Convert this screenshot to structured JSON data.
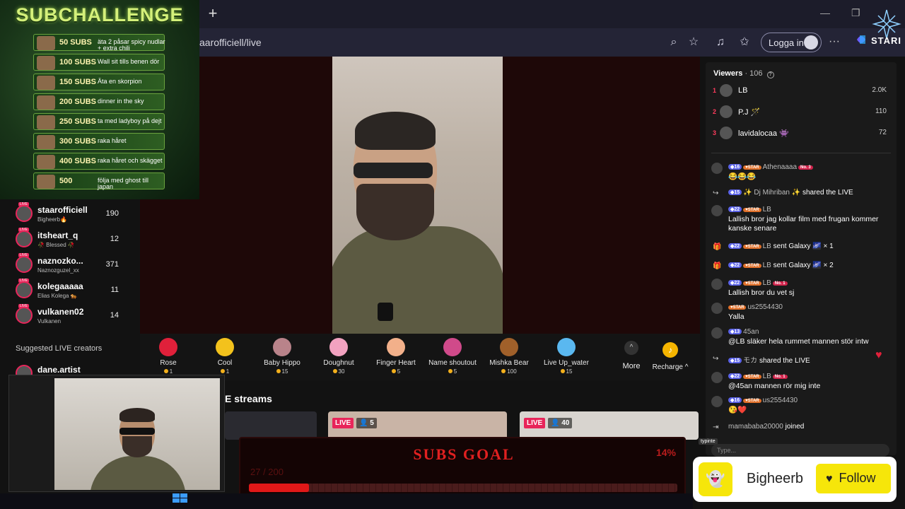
{
  "browser": {
    "url": "aarofficiell/live",
    "login_label": "Logga in",
    "brand": "STARI"
  },
  "subchallenge": {
    "title": "SUBCHALLENGE",
    "items": [
      {
        "subs": "50 SUBS",
        "text": "äta 2 påsar spicy nudlar + extra chili"
      },
      {
        "subs": "100 SUBS",
        "text": "Wall sit tills benen dör"
      },
      {
        "subs": "150 SUBS",
        "text": "Äta en skorpion"
      },
      {
        "subs": "200 SUBS",
        "text": "dinner in the sky"
      },
      {
        "subs": "250 SUBS",
        "text": "ta med ladyboy på dejt"
      },
      {
        "subs": "300 SUBS",
        "text": "raka håret"
      },
      {
        "subs": "400 SUBS",
        "text": "raka håret och skägget"
      },
      {
        "subs": "500",
        "text": "följa med ghost till japan"
      }
    ]
  },
  "sidebar": {
    "accounts": [
      {
        "name": "staarofficiell",
        "sub": "Bigheerb🔥",
        "count": "190"
      },
      {
        "name": "itsheart_q",
        "sub": "🥀 Blessed 🥀",
        "count": "12"
      },
      {
        "name": "naznozko...",
        "sub": "Naznozguzel_xx",
        "count": "371"
      },
      {
        "name": "kolegaaaaa",
        "sub": "Elias Kolega 🐅",
        "count": "11"
      },
      {
        "name": "vulkanen02",
        "sub": "Vulkanen",
        "count": "14"
      }
    ],
    "suggested_heading": "Suggested LIVE creators",
    "suggested_first": "dane.artist"
  },
  "gifts": [
    {
      "name": "Rose",
      "cost": "1",
      "color": "#e0203a"
    },
    {
      "name": "Cool",
      "cost": "1",
      "color": "#f3c21c"
    },
    {
      "name": "Baby Hippo",
      "cost": "15",
      "color": "#b9838a"
    },
    {
      "name": "Doughnut",
      "cost": "30",
      "color": "#f2a2c0"
    },
    {
      "name": "Finger Heart",
      "cost": "5",
      "color": "#f2b08a"
    },
    {
      "name": "Name shoutout",
      "cost": "5",
      "color": "#d04a8a"
    },
    {
      "name": "Mishka Bear",
      "cost": "100",
      "color": "#a0602a"
    },
    {
      "name": "Live Up_water",
      "cost": "15",
      "color": "#5ab8f0"
    }
  ],
  "gifts_more_label": "More",
  "recharge_label": "Recharge ^",
  "streams": {
    "title": "E streams",
    "thumbs": [
      {
        "badge": "LIVE",
        "count": "5"
      },
      {
        "badge": "LIVE",
        "count": "40"
      }
    ]
  },
  "subs_goal": {
    "title": "SUBS GOAL",
    "percent": "14%",
    "count": "27 / 200",
    "progress": 0.14
  },
  "viewers": {
    "label": "Viewers",
    "count": "· 106",
    "top": [
      {
        "rank": "1",
        "name": "LB",
        "score": "2.0K"
      },
      {
        "rank": "2",
        "name": "P.J 🪄",
        "score": "110"
      },
      {
        "rank": "3",
        "name": "lavidalocaa 👾",
        "score": "72"
      }
    ]
  },
  "chat": [
    {
      "icon": "avatar",
      "level": "16",
      "star": true,
      "user": "Athenaaaa",
      "no1": "No. 3",
      "action": "",
      "body": "😂😂😂"
    },
    {
      "icon": "share",
      "level": "15",
      "star": false,
      "user": "✨ Dj Mihriban ✨",
      "no1": "",
      "action": "shared the LIVE",
      "body": ""
    },
    {
      "icon": "avatar",
      "level": "22",
      "star": true,
      "user": "LB",
      "no1": "",
      "action": "",
      "body": "Lallish bror jag kollar film med frugan kommer kanske senare"
    },
    {
      "icon": "gift",
      "level": "22",
      "star": true,
      "user": "LB",
      "no1": "",
      "action": "sent Galaxy 🌌 × 1",
      "body": ""
    },
    {
      "icon": "gift",
      "level": "22",
      "star": true,
      "user": "LB",
      "no1": "",
      "action": "sent Galaxy 🌌 × 2",
      "body": ""
    },
    {
      "icon": "avatar",
      "level": "22",
      "star": true,
      "user": "LB",
      "no1": "No. 1",
      "action": "",
      "body": "Lallish bror du vet sj"
    },
    {
      "icon": "avatar",
      "level": "",
      "star": true,
      "user": "us2554430",
      "no1": "",
      "action": "",
      "body": "Yalla"
    },
    {
      "icon": "avatar",
      "level": "13",
      "star": false,
      "user": "45an",
      "no1": "",
      "action": "",
      "body": "@LB släker hela rummet mannen stör intw"
    },
    {
      "icon": "share",
      "level": "15",
      "star": false,
      "user": "モカ",
      "no1": "",
      "action": "shared the LIVE",
      "body": ""
    },
    {
      "icon": "avatar",
      "level": "22",
      "star": true,
      "user": "LB",
      "no1": "No. 1",
      "action": "",
      "body": "@45an mannen rör mig inte"
    },
    {
      "icon": "avatar",
      "level": "16",
      "star": true,
      "user": "us2554430",
      "no1": "",
      "action": "",
      "body": "😘❤️"
    },
    {
      "icon": "join",
      "level": "",
      "star": false,
      "user": "mamababa20000",
      "no1": "",
      "action": "joined",
      "body": ""
    }
  ],
  "chat_input_placeholder": "Type...",
  "typing_label": "typinte",
  "follow_card": {
    "name": "Bigheerb",
    "button": "Follow"
  }
}
